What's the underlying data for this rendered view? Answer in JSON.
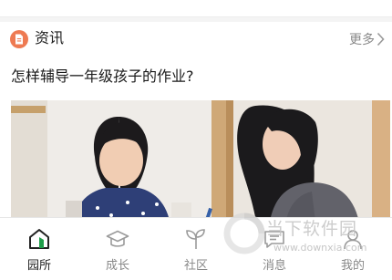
{
  "news": {
    "section_title": "资讯",
    "more_label": "更多",
    "headline": "怎样辅导一年级孩子的作业?"
  },
  "tabbar": {
    "items": [
      {
        "label": "园所",
        "icon": "home-icon",
        "active": true
      },
      {
        "label": "成长",
        "icon": "graduation-cap-icon",
        "active": false
      },
      {
        "label": "社区",
        "icon": "sprout-icon",
        "active": false
      },
      {
        "label": "消息",
        "icon": "message-icon",
        "active": false
      },
      {
        "label": "我的",
        "icon": "user-icon",
        "active": false
      }
    ]
  },
  "watermark": {
    "brand": "当下软件园",
    "url": "www.downxia.com"
  },
  "colors": {
    "accent": "#ee7a52",
    "active_home": "#1f9e4a",
    "inactive": "#888888"
  }
}
